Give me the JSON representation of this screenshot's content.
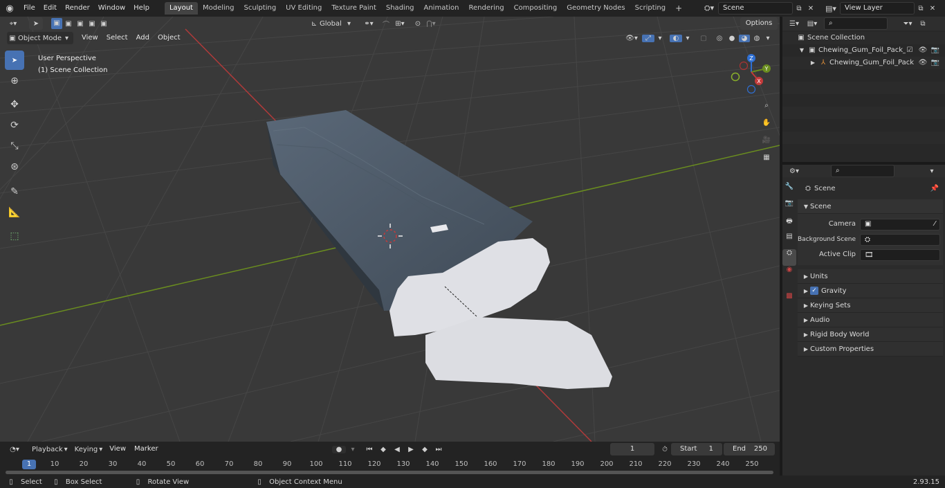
{
  "menu": {
    "file": "File",
    "edit": "Edit",
    "render": "Render",
    "window": "Window",
    "help": "Help"
  },
  "workspaces": [
    "Layout",
    "Modeling",
    "Sculpting",
    "UV Editing",
    "Texture Paint",
    "Shading",
    "Animation",
    "Rendering",
    "Compositing",
    "Geometry Nodes",
    "Scripting"
  ],
  "workspace_add": "+",
  "scene_field": "Scene",
  "view_layer_field": "View Layer",
  "viewport": {
    "mode": "Object Mode",
    "menus": {
      "view": "View",
      "select": "Select",
      "add": "Add",
      "object": "Object"
    },
    "transform_orientation": "Global",
    "options": "Options",
    "overlay_title": "User Perspective",
    "overlay_collection": "(1) Scene Collection",
    "gizmo": {
      "x": "X",
      "y": "Y",
      "z": "Z"
    }
  },
  "outliner": {
    "root": "Scene Collection",
    "items": [
      {
        "label": "Chewing_Gum_Foil_Pack_Opene"
      },
      {
        "label": "Chewing_Gum_Foil_Pack"
      }
    ]
  },
  "properties": {
    "context": "Scene",
    "panel_scene": "Scene",
    "camera_label": "Camera",
    "background_label": "Background Scene",
    "clip_label": "Active Clip",
    "panels": [
      "Units",
      "Gravity",
      "Keying Sets",
      "Audio",
      "Rigid Body World",
      "Custom Properties"
    ]
  },
  "timeline": {
    "menus": {
      "playback": "Playback",
      "keying": "Keying",
      "view": "View",
      "marker": "Marker"
    },
    "current_frame": "1",
    "start_label": "Start",
    "start_value": "1",
    "end_label": "End",
    "end_value": "250",
    "ruler": [
      "10",
      "20",
      "30",
      "40",
      "50",
      "60",
      "70",
      "80",
      "90",
      "100",
      "110",
      "120",
      "130",
      "140",
      "150",
      "160",
      "170",
      "180",
      "190",
      "200",
      "210",
      "220",
      "230",
      "240",
      "250"
    ],
    "ruler_current": "1"
  },
  "status": {
    "select": "Select",
    "box_select": "Box Select",
    "rotate": "Rotate View",
    "context_menu": "Object Context Menu",
    "version": "2.93.15"
  },
  "colors": {
    "accent": "#4772b3",
    "x_axis": "#c43b3b",
    "y_axis": "#6a8d1f",
    "z_axis": "#2e6fd3"
  }
}
